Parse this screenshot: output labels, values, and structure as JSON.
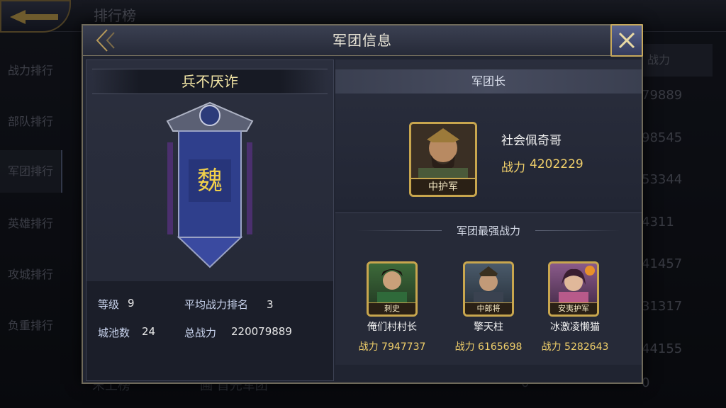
{
  "background": {
    "title": "排行榜",
    "sidebar": [
      "战力排行",
      "部队排行",
      "军团排行",
      "英雄排行",
      "攻城排行",
      "负重排行"
    ],
    "column_header": "战力",
    "column_values": [
      "79889",
      "98545",
      "53344",
      "4311",
      "41457",
      "31317",
      "44155",
      "0"
    ],
    "footer_left": "末上榜",
    "footer_mid": "圃 首先军团",
    "footer_num": "0"
  },
  "dialog": {
    "title": "军团信息",
    "legion_name": "兵不厌诈",
    "banner_char": "魏",
    "stats": {
      "level_label": "等级",
      "level": "9",
      "avg_rank_label": "平均战力排名",
      "avg_rank": "3",
      "cities_label": "城池数",
      "cities": "24",
      "total_power_label": "总战力",
      "total_power": "220079889"
    },
    "leader": {
      "section_title": "军团长",
      "name": "社会佩奇哥",
      "power_label": "战力",
      "power": "4202229",
      "rank_tag": "中护军"
    },
    "strongest": {
      "section_title": "军团最强战力",
      "heroes": [
        {
          "tag": "刺史",
          "name": "俺们村村长",
          "power_label": "战力",
          "power": "7947737"
        },
        {
          "tag": "中郎将",
          "name": "擎天柱",
          "power_label": "战力",
          "power": "6165698"
        },
        {
          "tag": "安夷护军",
          "name": "冰激凌懒猫",
          "power_label": "战力",
          "power": "5282643"
        }
      ]
    }
  },
  "colors": {
    "gold": "#c8a64e",
    "accent_yellow": "#f0cf6a",
    "panel": "#202431"
  }
}
